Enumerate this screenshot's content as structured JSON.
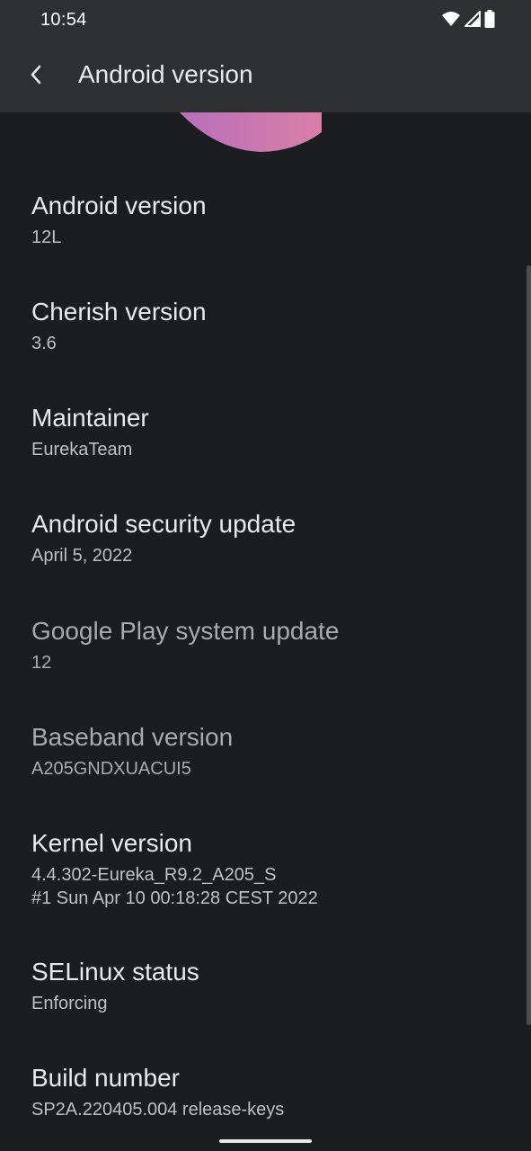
{
  "status_bar": {
    "time": "10:54",
    "icons": [
      "wifi-icon",
      "cell-signal-icon",
      "battery-icon"
    ]
  },
  "app_bar": {
    "back_icon": "back-arrow-icon",
    "title": "Android version"
  },
  "colors": {
    "background": "#1b1d20",
    "bar": "#2e3032",
    "illustration_pink": "#c77bb0"
  },
  "items": [
    {
      "title": "Android version",
      "summary": "12L"
    },
    {
      "title": "Cherish version",
      "summary": "3.6"
    },
    {
      "title": "Maintainer",
      "summary": "EurekaTeam"
    },
    {
      "title": "Android security update",
      "summary": "April 5, 2022"
    },
    {
      "title": "Google Play system update",
      "summary": "12"
    },
    {
      "title": "Baseband version",
      "summary": "A205GNDXUACUI5"
    },
    {
      "title": "Kernel version",
      "summary": "4.4.302-Eureka_R9.2_A205_S\n#1 Sun Apr 10 00:18:28 CEST 2022"
    },
    {
      "title": "SELinux status",
      "summary": "Enforcing"
    },
    {
      "title": "Build number",
      "summary": "SP2A.220405.004 release-keys"
    }
  ]
}
